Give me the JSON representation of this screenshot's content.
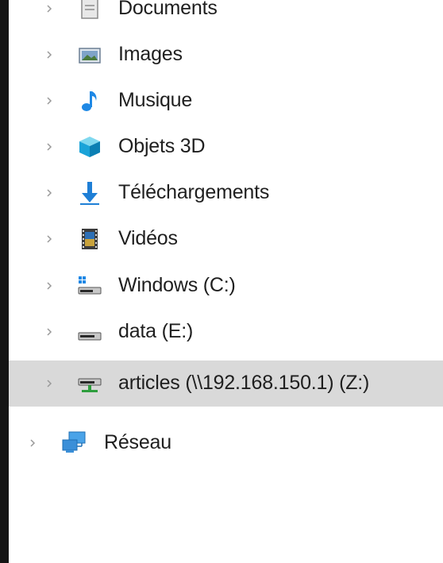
{
  "tree": {
    "items": [
      {
        "label": "Documents"
      },
      {
        "label": "Images"
      },
      {
        "label": "Musique"
      },
      {
        "label": "Objets 3D"
      },
      {
        "label": "Téléchargements"
      },
      {
        "label": "Vidéos"
      },
      {
        "label": "Windows (C:)"
      },
      {
        "label": "data (E:)"
      },
      {
        "label": "articles (\\\\192.168.150.1) (Z:)",
        "selected": true
      },
      {
        "label": "Réseau"
      }
    ]
  },
  "colors": {
    "selected_row": "#d9d9d9",
    "text": "#1f1f1f",
    "chevron": "#9a9a9a",
    "left_border": "#141414"
  }
}
